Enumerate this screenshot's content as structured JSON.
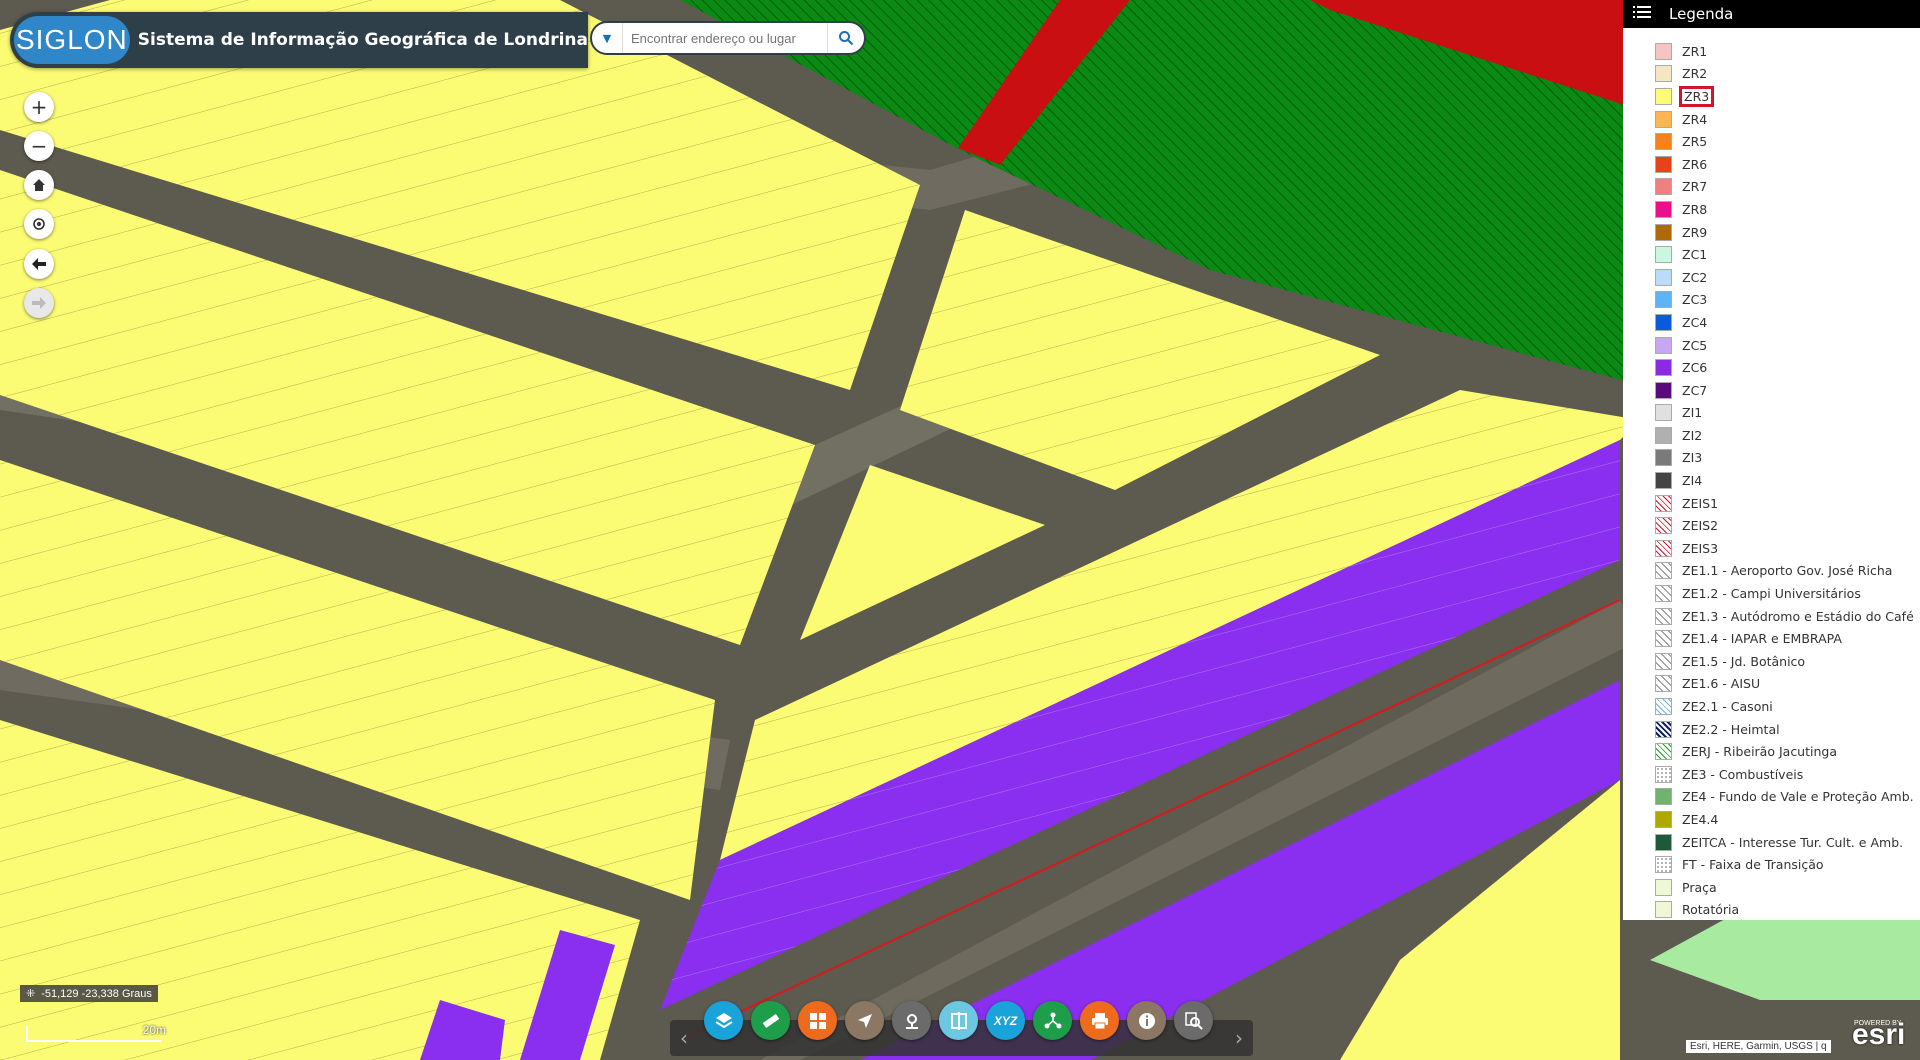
{
  "header": {
    "logo_text": "SIGLON",
    "title": "Sistema de Informação Geográfica de Londrina"
  },
  "search": {
    "placeholder": "Encontrar endereço ou lugar",
    "dropdown_icon": "caret-down-icon",
    "button_icon": "search-icon"
  },
  "map_controls": [
    "zoom-in",
    "zoom-out",
    "home",
    "locate",
    "back",
    "forward"
  ],
  "legend": {
    "title": "Legenda",
    "items": [
      {
        "label": "ZR1",
        "color": "#f7c4c4"
      },
      {
        "label": "ZR2",
        "color": "#f3e6c1"
      },
      {
        "label": "ZR3",
        "color": "#fefb76",
        "highlight": true
      },
      {
        "label": "ZR4",
        "color": "#fbb651"
      },
      {
        "label": "ZR5",
        "color": "#f5821f"
      },
      {
        "label": "ZR6",
        "color": "#e9421a"
      },
      {
        "label": "ZR7",
        "color": "#f08080"
      },
      {
        "label": "ZR8",
        "color": "#e8108e"
      },
      {
        "label": "ZR9",
        "color": "#ad6a06"
      },
      {
        "label": "ZC1",
        "color": "#c8f7e2"
      },
      {
        "label": "ZC2",
        "color": "#b9dcf7"
      },
      {
        "label": "ZC3",
        "color": "#5ab4f7"
      },
      {
        "label": "ZC4",
        "color": "#0a5ae0"
      },
      {
        "label": "ZC5",
        "color": "#c7a6f2"
      },
      {
        "label": "ZC6",
        "color": "#8a2be2"
      },
      {
        "label": "ZC7",
        "color": "#5a0a7a"
      },
      {
        "label": "ZI1",
        "color": "#e0e0e0"
      },
      {
        "label": "ZI2",
        "color": "#b0b0b0"
      },
      {
        "label": "ZI3",
        "color": "#7a7a7a"
      },
      {
        "label": "ZI4",
        "color": "#444444"
      },
      {
        "label": "ZEIS1",
        "pattern": "red"
      },
      {
        "label": "ZEIS2",
        "pattern": "red"
      },
      {
        "label": "ZEIS3",
        "pattern": "red"
      },
      {
        "label": "ZE1.1 - Aeroporto Gov. José Richa",
        "pattern": "gray"
      },
      {
        "label": "ZE1.2 - Campi Universitários",
        "pattern": "gray"
      },
      {
        "label": "ZE1.3 - Autódromo e Estádio do Café",
        "pattern": "gray"
      },
      {
        "label": "ZE1.4 - IAPAR e EMBRAPA",
        "pattern": "gray"
      },
      {
        "label": "ZE1.5 - Jd. Botânico",
        "pattern": "gray"
      },
      {
        "label": "ZE1.6 - AISU",
        "pattern": "gray"
      },
      {
        "label": "ZE2.1 - Casoni",
        "pattern": "lightblue"
      },
      {
        "label": "ZE2.2 - Heimtal",
        "pattern": "navy"
      },
      {
        "label": "ZERJ - Ribeirão Jacutinga",
        "pattern": "green"
      },
      {
        "label": "ZE3 - Combustíveis",
        "pattern": "dots"
      },
      {
        "label": "ZE4 - Fundo de Vale e Proteção Amb.",
        "color": "#6fb36f"
      },
      {
        "label": "ZE4.4",
        "color": "#b0a800"
      },
      {
        "label": "ZEITCA - Interesse Tur. Cult. e Amb.",
        "color": "#1e5a3a"
      },
      {
        "label": "FT - Faixa de Transição",
        "pattern": "dots"
      },
      {
        "label": "Praça",
        "color": "#eef7d6"
      },
      {
        "label": "Rotatória",
        "color": "#eef7d6"
      }
    ]
  },
  "status": {
    "coordinates": "-51,129 -23,338 Graus",
    "scale": "20m"
  },
  "toolbar": {
    "tools": [
      {
        "name": "layers-icon",
        "color": "#1aa3d9"
      },
      {
        "name": "measure-icon",
        "color": "#1e9e4a"
      },
      {
        "name": "basemap-gallery-icon",
        "color": "#ec6b1f"
      },
      {
        "name": "filter-icon",
        "color": "#8b7763"
      },
      {
        "name": "location-pin-icon",
        "color": "#6b6b6b"
      },
      {
        "name": "swipe-icon",
        "color": "#6bc8e0"
      },
      {
        "name": "xyz-coordinates-icon",
        "color": "#1aa3d9"
      },
      {
        "name": "share-icon",
        "color": "#1e9e4a"
      },
      {
        "name": "print-icon",
        "color": "#ec6b1f"
      },
      {
        "name": "info-icon",
        "color": "#8b7763"
      },
      {
        "name": "identify-icon",
        "color": "#6b6b6b"
      }
    ],
    "xyz_label": "XYZ"
  },
  "attribution": "Esri, HERE, Garmin, USGS | q",
  "esri_logo": "esri",
  "esri_powered": "POWERED BY"
}
